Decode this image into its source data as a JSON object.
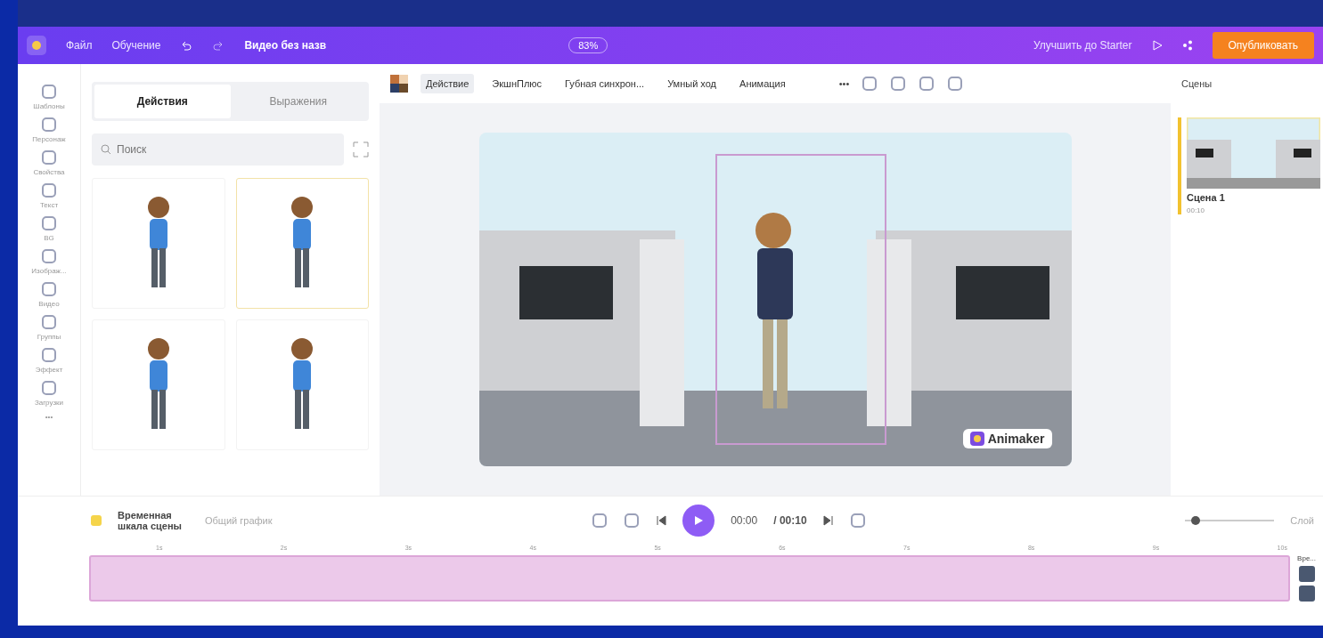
{
  "header": {
    "menu": [
      "Файл",
      "Обучение"
    ],
    "title": "Видео без назв",
    "zoom": "83%",
    "upgrade": "Улучшить до Starter",
    "publish": "Опубликовать"
  },
  "sidebar": {
    "items": [
      "Шаблоны",
      "Персонаж",
      "Свойства",
      "Текст",
      "BG",
      "Изображ...",
      "Видео",
      "Группы",
      "Эффект",
      "Загрузки"
    ],
    "more": "•••"
  },
  "panel": {
    "tabs": [
      {
        "label": "Действия",
        "selected": true
      },
      {
        "label": "Выражения",
        "selected": false
      }
    ],
    "search": {
      "placeholder": "Поиск"
    },
    "thumbs": [
      {
        "selected": false
      },
      {
        "selected": true
      },
      {
        "selected": false
      },
      {
        "selected": false
      }
    ]
  },
  "toolbar": {
    "items": [
      {
        "label": "Действие",
        "selected": true
      },
      {
        "label": "ЭкшнПлюс",
        "selected": false
      },
      {
        "label": "Губная синхрон...",
        "selected": false
      },
      {
        "label": "Умный ход",
        "selected": false
      },
      {
        "label": "Анимация",
        "selected": false
      }
    ],
    "more": "•••"
  },
  "canvas": {
    "badge": "Animaker"
  },
  "scenes": {
    "title": "Сцены",
    "items": [
      {
        "name": "Сцена 1",
        "duration": "00:10",
        "selected": true
      }
    ]
  },
  "timeline": {
    "title": "Временная шкала сцены",
    "overall": "Общий график",
    "time": "00:00",
    "total": "/ 00:10",
    "zoom": {
      "level": 0.12
    },
    "layer": "Слой",
    "ticks": [
      "1s",
      "2s",
      "3s",
      "4s",
      "5s",
      "6s",
      "7s",
      "8s",
      "9s",
      "10s"
    ],
    "side_label": "Вре..."
  }
}
